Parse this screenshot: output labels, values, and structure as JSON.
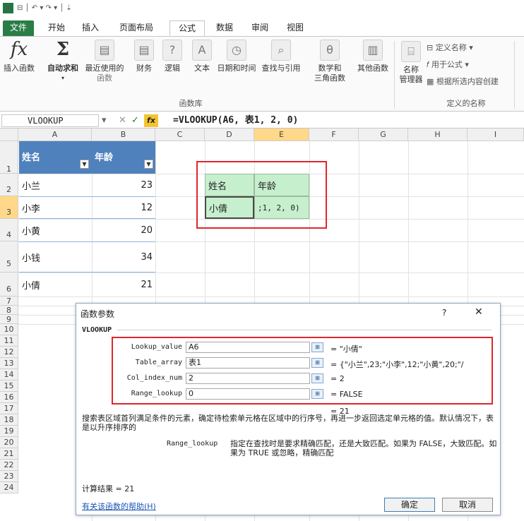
{
  "qat": {
    "excel_icon": "X",
    "quick_tools": "⊟ │ ↶ ▾ ↷ ▾ │ ⇣"
  },
  "tabs": [
    "文件",
    "开始",
    "插入",
    "页面布局",
    "公式",
    "数据",
    "审阅",
    "视图"
  ],
  "ribbon": {
    "insert_function": "插入函数",
    "autosum": "自动求和",
    "recent_line1": "最近使用的",
    "recent_line2": "函数",
    "financial": "财务",
    "logical": "逻辑",
    "text": "文本",
    "datetime": "日期和时间",
    "lookup": "查找与引用",
    "math_line1": "数学和",
    "math_line2": "三角函数",
    "other": "其他函数",
    "name_line1": "名称",
    "name_line2": "管理器",
    "define_name": "定义名称",
    "use_in_formula": "用于公式",
    "create_from_selection": "根据所选内容创建",
    "group_library": "函数库",
    "group_defined_names": "定义的名称"
  },
  "formula_bar": {
    "name_box": "VLOOKUP",
    "formula": "=VLOOKUP(A6, 表1, 2, 0)"
  },
  "columns": [
    "A",
    "B",
    "C",
    "D",
    "E",
    "F",
    "G",
    "H",
    "I"
  ],
  "rows": [
    "1",
    "2",
    "3",
    "4",
    "5",
    "6",
    "7",
    "8",
    "9",
    "10",
    "11",
    "12",
    "13",
    "14",
    "15",
    "16",
    "17",
    "18",
    "19",
    "20",
    "21",
    "22",
    "23",
    "24"
  ],
  "table": {
    "header": [
      "姓名",
      "年龄"
    ],
    "rows": [
      {
        "name": "小兰",
        "age": "23"
      },
      {
        "name": "小李",
        "age": "12"
      },
      {
        "name": "小黄",
        "age": "20"
      },
      {
        "name": "小钱",
        "age": "34"
      },
      {
        "name": "小倩",
        "age": "21"
      }
    ]
  },
  "lookup": {
    "header_name": "姓名",
    "header_age": "年龄",
    "name_value": "小倩",
    "editing_text": ";1, 2, 0)"
  },
  "dialog": {
    "title": "函数参数",
    "help_glyph": "?",
    "close_glyph": "✕",
    "function_name": "VLOOKUP",
    "args": [
      {
        "label": "Lookup_value",
        "value": "A6",
        "result": "= \"小倩\""
      },
      {
        "label": "Table_array",
        "value": "表1",
        "result": "= {\"小兰\",23;\"小李\",12;\"小黄\",20;\"/"
      },
      {
        "label": "Col_index_num",
        "value": "2",
        "result": "= 2"
      },
      {
        "label": "Range_lookup",
        "value": "0",
        "result": "= FALSE"
      }
    ],
    "total_result": "= 21",
    "description": "搜索表区域首列满足条件的元素，确定待检索单元格在区域中的行序号，再进一步返回选定单元格的值。默认情况下，表是以升序排序的",
    "arg_help_label": "Range_lookup",
    "arg_help_text": "指定在查找时是要求精确匹配，还是大致匹配。如果为 FALSE，大致匹配。如果为 TRUE 或忽略，精确匹配",
    "calc_result": "计算结果 = 21",
    "help_link": "有关该函数的帮助(H)",
    "ok": "确定",
    "cancel": "取消"
  },
  "colors": {
    "accent_green": "#2a7d46",
    "table_header": "#4f81bd",
    "highlight": "#e0262e",
    "green_fill": "#c6efce"
  }
}
